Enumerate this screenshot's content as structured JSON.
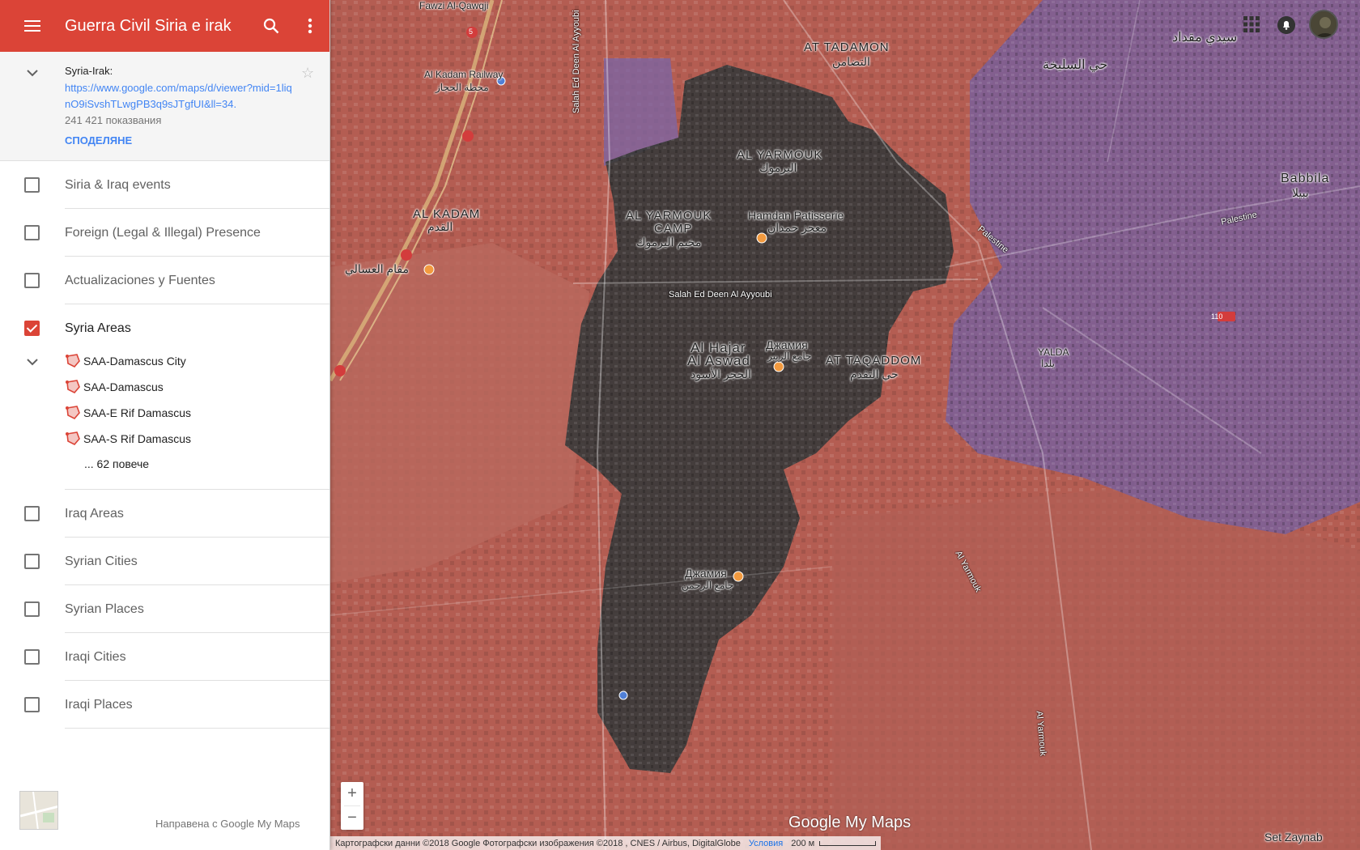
{
  "header": {
    "title": "Guerra Civil Siria e irak"
  },
  "info": {
    "title": "Syria-Irak:",
    "url": "https://www.google.com/maps/d/viewer?mid=1liqnO9iSvshTLwgPB3q9sJTgfUI&ll=34.",
    "views": "241 421 показвания",
    "share_label": "СПОДЕЛЯНЕ"
  },
  "layers": [
    {
      "name": "Siria & Iraq events",
      "checked": false
    },
    {
      "name": "Foreign (Legal & Illegal) Presence",
      "checked": false
    },
    {
      "name": "Actualizaciones y Fuentes",
      "checked": false
    },
    {
      "name": "Syria Areas",
      "checked": true
    },
    {
      "name": "Iraq Areas",
      "checked": false
    },
    {
      "name": "Syrian Cities",
      "checked": false
    },
    {
      "name": "Syrian Places",
      "checked": false
    },
    {
      "name": "Iraqi Cities",
      "checked": false
    },
    {
      "name": "Iraqi Places",
      "checked": false
    }
  ],
  "syria_areas_items": [
    "SAA-Damascus City",
    "SAA-Damascus",
    "SAA-E Rif Damascus",
    "SAA-S Rif Damascus"
  ],
  "more_label": "... 62 повече",
  "footer": {
    "made_with": "Направена с Google My Maps"
  },
  "map": {
    "labels": {
      "at_tadamon": "AT TADAMON",
      "at_tadamon_ar": "التضامن",
      "al_yarmouk": "AL YARMOUK",
      "al_yarmouk_ar": "اليرموك",
      "al_yarmouk_camp": "AL YARMOUK",
      "camp": "CAMP",
      "camp_ar": "مخيم اليرموك",
      "hamdan": "Hamdan Patisserie",
      "hamdan_ar": "معجز حمدان",
      "al_kadam": "AL KADAM",
      "al_kadam_ar": "القدم",
      "al_kadam_railway": "Al Kadam Railway",
      "al_kadam_railway_ar": "محطة الحجاز",
      "al_hajar": "Al Hajar",
      "al_aswad": "Al Aswad",
      "al_hajar_ar": "الحجر الأسود",
      "at_taqaddom": "AT TAQADDOM",
      "at_taqaddom_ar": "حي التقدم",
      "mosque1": "Джамия",
      "mosque1_ar": "جامع الزبير",
      "mosque2": "Джамия",
      "mosque2_ar": "جامع الرحمن",
      "salah_ed_deen": "Salah Ed Deen Al Ayyoubi",
      "salah_vertical": "Salah Ed Deen Al Ayyoubi",
      "palestine": "Palestine",
      "palestine2": "Palestine",
      "al_yarmouk_st": "Al Yarmouk",
      "al_yarmouk_st2": "Al Yarmouk",
      "yalda": "YALDA",
      "yalda_ar": "يلدا",
      "babbila": "Babbila",
      "babbila_ar": "ببيلا",
      "sidi_meqdad": "سيدي مقداد",
      "saljeh": "حي السليخة",
      "fawzi": "Fawzi Al-Qawqji",
      "sayyida": "Set Zaynab",
      "mosque_asali": "مقام العسالي",
      "route_110": "110",
      "route_5": "5"
    },
    "zoom_in": "+",
    "zoom_out": "−",
    "logo": "Google My Maps",
    "attribution": "Картографски данни ©2018 Google Фотографски изображения ©2018 , CNES / Airbus, DigitalGlobe",
    "terms": "Условия",
    "scale": "200 м"
  },
  "colors": {
    "accent": "#db4437",
    "link": "#4285f4",
    "zone_red": "#c0564b",
    "zone_dark": "#3a3a3a",
    "zone_purple": "#7e6aa8"
  },
  "icons": {
    "menu": "menu-icon",
    "search": "search-icon",
    "more": "more-vert-icon",
    "collapse": "chevron-down-icon",
    "star": "star-icon",
    "pin": "polygon-pin-icon"
  }
}
